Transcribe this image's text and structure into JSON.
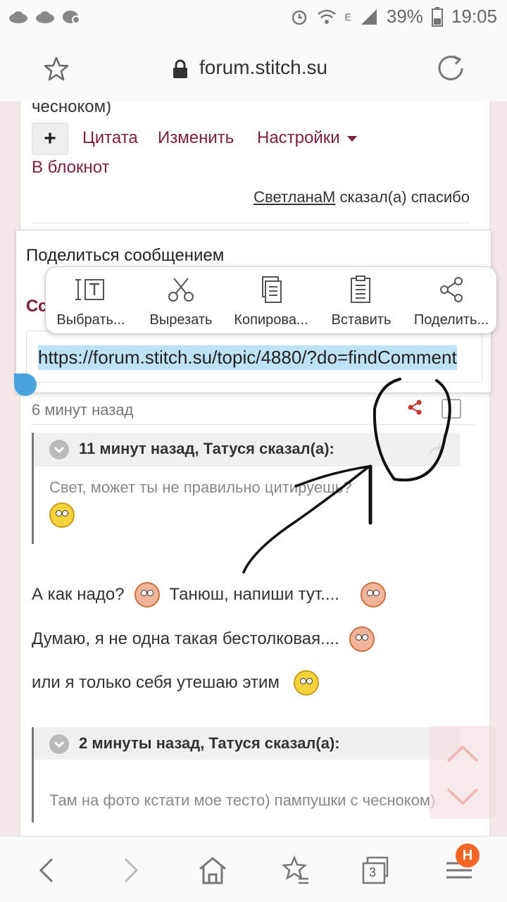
{
  "status_bar": {
    "battery": "39%",
    "time": "19:05",
    "network_label": "E"
  },
  "browser": {
    "domain": "forum.stitch.su"
  },
  "post_top": {
    "text_fragment": "чесноком)",
    "plus_label": "+",
    "quote_link": "Цитата",
    "edit_link": "Изменить",
    "settings_link": "Настройки",
    "notebook_link": "В блокнот",
    "thanks_user": "СветланаМ",
    "thanks_text": " сказал(а) спасибо"
  },
  "share_dialog": {
    "title": "Поделиться сообщением",
    "subtitle": "Сс",
    "url": "https://forum.stitch.su/topic/4880/?do=findComment"
  },
  "context_menu": {
    "items": [
      {
        "label": "Выбрать...",
        "icon": "select-text-icon"
      },
      {
        "label": "Вырезать",
        "icon": "scissors-icon"
      },
      {
        "label": "Копирова...",
        "icon": "copy-icon"
      },
      {
        "label": "Вставить",
        "icon": "paste-icon"
      },
      {
        "label": "Поделить...",
        "icon": "share-icon"
      }
    ]
  },
  "post": {
    "time_ago": "6 минут назад",
    "quote1": {
      "header": "11 минут назад, Татуся сказал(а):",
      "body": "Свет, может ты не правильно цитируешь?"
    },
    "lines": [
      {
        "before": "А как надо?",
        "after": "Танюш, напиши тут...."
      },
      {
        "before": " Думаю, я не одна такая бестолковая...."
      },
      {
        "before": "или я только себя утешаю этим"
      }
    ],
    "quote2": {
      "header": "2 минуты назад, Татуся сказал(а):",
      "body": "Там на фото кстати мое тесто) пампушки с чесноком)"
    }
  },
  "bottom_nav": {
    "tabs_count": "3",
    "badge": "H"
  },
  "colors": {
    "accent": "#7a1f3d",
    "selection": "#bfe2f7",
    "badge": "#f26522"
  }
}
